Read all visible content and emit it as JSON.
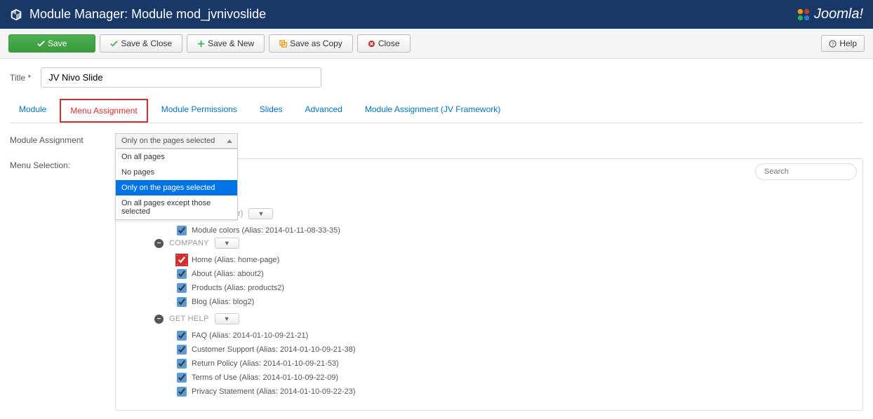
{
  "header": {
    "title": "Module Manager: Module mod_jvnivoslide",
    "brand": "Joomla!"
  },
  "toolbar": {
    "save": "Save",
    "save_close": "Save & Close",
    "save_new": "Save & New",
    "save_copy": "Save as Copy",
    "close": "Close",
    "help": "Help"
  },
  "title_field": {
    "label": "Title *",
    "value": "JV Nivo Slide"
  },
  "tabs": {
    "t1": "Module",
    "t2": "Menu Assignment",
    "t3": "Module Permissions",
    "t4": "Slides",
    "t5": "Advanced",
    "t6": "Module Assignment (JV Framework)"
  },
  "assignment": {
    "label": "Module Assignment",
    "selected": "Only on the pages selected",
    "options": {
      "o1": "On all pages",
      "o2": "No pages",
      "o3": "Only on the pages selected",
      "o4": "On all pages except those selected"
    }
  },
  "menu_selection": {
    "label": "Menu Selection:",
    "search_placeholder": "Search"
  },
  "tree": {
    "color_item": "Module colors (Alias: 2014-01-11-08-33-35)",
    "groups": {
      "company": {
        "name": "COMPANY",
        "items": {
          "i1": "Home (Alias: home-page)",
          "i2": "About (Alias: about2)",
          "i3": "Products (Alias: products2)",
          "i4": "Blog (Alias: blog2)"
        }
      },
      "gethelp": {
        "name": "GET HELP",
        "items": {
          "i1": "FAQ (Alias: 2014-01-10-09-21-21)",
          "i2": "Customer Support (Alias: 2014-01-10-09-21-38)",
          "i3": "Return Policy (Alias: 2014-01-10-09-21-53)",
          "i4": "Terms of Use (Alias: 2014-01-10-09-22-09)",
          "i5": "Privacy Statement (Alias: 2014-01-10-09-22-23)"
        }
      }
    }
  }
}
